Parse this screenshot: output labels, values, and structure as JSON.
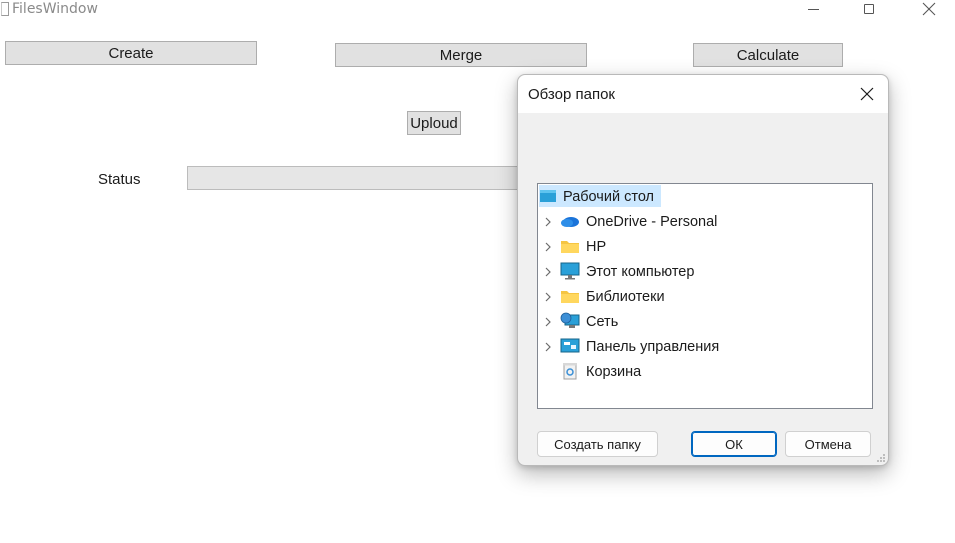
{
  "window": {
    "title": "FilesWindow"
  },
  "main": {
    "create_label": "Create",
    "merge_label": "Merge",
    "calculate_label": "Calculate",
    "upload_label": "Uploud",
    "status_label": "Status",
    "status_value": ""
  },
  "dialog": {
    "title": "Обзор папок",
    "tree": [
      {
        "label": "Рабочий стол",
        "icon": "desktop-icon",
        "expandable": false,
        "selected": true
      },
      {
        "label": "OneDrive - Personal",
        "icon": "onedrive-icon",
        "expandable": true
      },
      {
        "label": "HP",
        "icon": "folder-icon",
        "expandable": true
      },
      {
        "label": "Этот компьютер",
        "icon": "computer-icon",
        "expandable": true
      },
      {
        "label": "Библиотеки",
        "icon": "folder-icon",
        "expandable": true
      },
      {
        "label": "Сеть",
        "icon": "network-icon",
        "expandable": true
      },
      {
        "label": "Панель управления",
        "icon": "control-panel-icon",
        "expandable": true
      },
      {
        "label": "Корзина",
        "icon": "recycle-bin-icon",
        "expandable": false
      }
    ],
    "new_folder_label": "Создать папку",
    "ok_label": "ОК",
    "cancel_label": "Отмена"
  },
  "colors": {
    "selection": "#cce8ff",
    "accent": "#0067c0",
    "button_face": "#e1e1e1"
  }
}
